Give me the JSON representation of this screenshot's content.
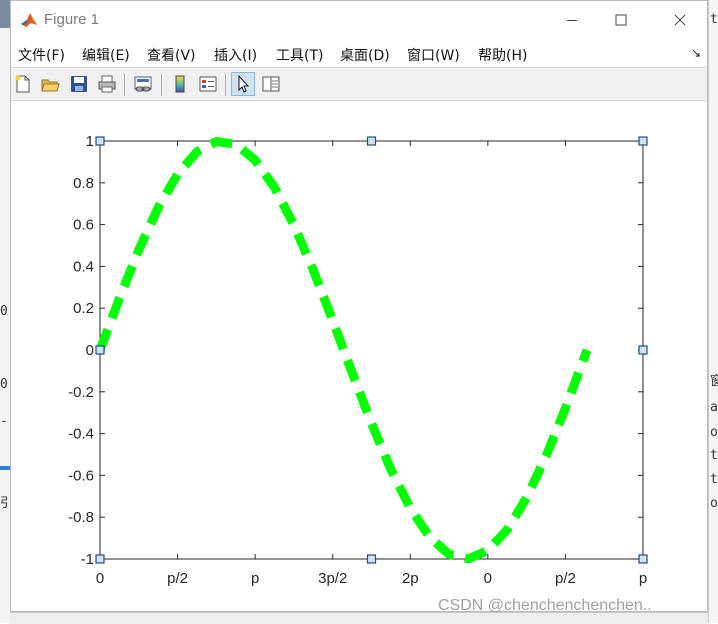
{
  "window": {
    "title": "Figure 1"
  },
  "menubar": {
    "items": [
      "文件(F)",
      "编辑(E)",
      "查看(V)",
      "插入(I)",
      "工具(T)",
      "桌面(D)",
      "窗口(W)",
      "帮助(H)"
    ],
    "overflow_icon": "dock-arrow-icon"
  },
  "toolbar": {
    "buttons": [
      "new-figure-icon",
      "open-file-icon",
      "save-icon",
      "print-icon",
      "link-plot-icon",
      "colorbar-icon",
      "legend-icon",
      "edit-plot-pointer-icon",
      "property-inspector-icon"
    ],
    "active": "edit-plot-pointer-icon"
  },
  "background": {
    "left_fragments": [
      "0",
      "0",
      "-",
      "引"
    ],
    "right_fragments": [
      "ti",
      "窗",
      "a",
      "o",
      "t",
      "t",
      "o"
    ]
  },
  "chart_data": {
    "type": "line",
    "title": "",
    "xlabel": "",
    "ylabel": "",
    "xlim": [
      0,
      7
    ],
    "ylim": [
      -1,
      1
    ],
    "xticks": [
      0,
      1,
      2,
      3,
      4,
      5,
      6,
      7
    ],
    "xtick_labels": [
      "0",
      "p/2",
      "p",
      "3p/2",
      "2p",
      "0",
      "p/2",
      "p"
    ],
    "yticks": [
      -1,
      -0.8,
      -0.6,
      -0.4,
      -0.2,
      0,
      0.2,
      0.4,
      0.6,
      0.8,
      1
    ],
    "ytick_labels": [
      "-1",
      "-0.8",
      "-0.6",
      "-0.4",
      "-0.2",
      "0",
      "0.2",
      "0.4",
      "0.6",
      "0.8",
      "1"
    ],
    "series": [
      {
        "color": "#00ff00",
        "line_style": "dashed",
        "function": "sin(x)",
        "x": [
          0,
          0.25,
          0.5,
          0.75,
          1.0,
          1.25,
          1.5,
          1.75,
          2.0,
          2.25,
          2.5,
          2.75,
          3.0,
          3.25,
          3.5,
          3.75,
          4.0,
          4.25,
          4.5,
          4.75,
          5.0,
          5.25,
          5.5,
          5.75,
          6.0,
          6.28
        ],
        "y": [
          0,
          0.247,
          0.479,
          0.682,
          0.841,
          0.949,
          0.997,
          0.984,
          0.909,
          0.778,
          0.598,
          0.382,
          0.141,
          -0.108,
          -0.351,
          -0.572,
          -0.757,
          -0.895,
          -0.978,
          -0.999,
          -0.959,
          -0.859,
          -0.706,
          -0.508,
          -0.279,
          0.0
        ]
      }
    ],
    "grid": false,
    "legend": "none",
    "edit_handles": true
  },
  "watermark": "CSDN @chenchenchenchen.."
}
